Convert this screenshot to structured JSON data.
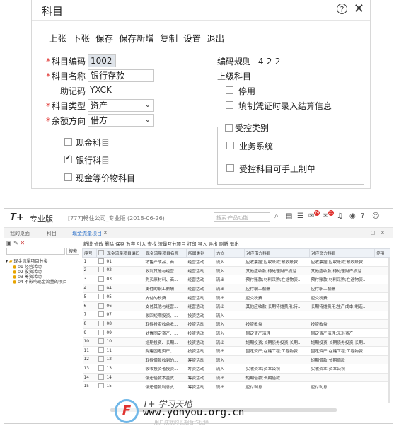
{
  "dialog": {
    "title": "科目",
    "toolbar": [
      "上张",
      "下张",
      "保存",
      "保存新增",
      "复制",
      "设置",
      "退出"
    ],
    "code_label": "科目编码",
    "code_value": "1002",
    "name_label": "科目名称",
    "name_value": "银行存款",
    "mnemonic_label": "助记码",
    "mnemonic_value": "YXCK",
    "type_label": "科目类型",
    "type_value": "资产",
    "balance_label": "余额方向",
    "balance_value": "借方",
    "rule_label": "编码规则",
    "rule_value": "4-2-2",
    "parent_label": "上级科目",
    "disable_label": "停用",
    "settle_label": "填制凭证时录入结算信息",
    "cash_label": "现金科目",
    "bank_label": "银行科目",
    "cash_equiv_label": "现金等价物科目",
    "controlled_label": "受控类别",
    "business_label": "业务系统",
    "manual_label": "受控科目可手工制单"
  },
  "app": {
    "logo": "T+",
    "brand": "专业版",
    "company": "[777]畅住公司_专业版   (2018-06-26)",
    "search_placeholder": "搜索:产品功能",
    "badge1": "74",
    "badge2": "21",
    "tabs": [
      "我的桌面",
      "科目",
      "现金流量项目"
    ],
    "tree_search_btn": "搜索",
    "tree_root": "现金流量项目分类",
    "tree_items": [
      "01 经营活动",
      "02 投资活动",
      "03 筹资活动",
      "04 不影响现金流量的项目"
    ],
    "toolbar": "新增  修改  删除  保存  放弃  引入  查找  流量互分项目  打印  导入  导出  刷新  退出",
    "columns": [
      "序号",
      "",
      "现金流量项目编码",
      "现金流量项目名称",
      "所属类别",
      "方向",
      "对应借方科目",
      "对应贷方科目",
      "停用"
    ],
    "rows": [
      [
        "1",
        "01",
        "销售产成品、商...",
        "经营活动",
        "流入",
        "应收票据;应收账款;预收账款",
        "应收票据;应收账款;预收账款"
      ],
      [
        "2",
        "02",
        "收到其他与经营...",
        "经营活动",
        "流入",
        "其他应收款;待处理财产损溢...",
        "其他应收款;待处理财产损溢..."
      ],
      [
        "3",
        "03",
        "购买原材料、商...",
        "经营活动",
        "流出",
        "预付账款;材料采购;在途物资...",
        "预付账款;材料采购;在途物资..."
      ],
      [
        "4",
        "04",
        "支付的职工薪酬",
        "经营活动",
        "流出",
        "应付职工薪酬",
        "应付职工薪酬"
      ],
      [
        "5",
        "05",
        "支付的税费",
        "经营活动",
        "流出",
        "应交税费",
        "应交税费"
      ],
      [
        "6",
        "06",
        "支付其他与经营...",
        "经营活动",
        "流出",
        "其他应收款;长期待摊费用;待...",
        "长期待摊费用;生产成本;制造..."
      ],
      [
        "7",
        "07",
        "收回短期投资、...",
        "投资活动",
        "流入",
        "",
        ""
      ],
      [
        "8",
        "08",
        "取得投资收益收...",
        "投资活动",
        "流入",
        "投资收益",
        "投资收益"
      ],
      [
        "9",
        "09",
        "处置固定资产、...",
        "投资活动",
        "流入",
        "固定资产清理",
        "固定资产清理;无形资产"
      ],
      [
        "10",
        "10",
        "短期投资、长期...",
        "投资活动",
        "流出",
        "短期投资;长期债券投资;长期...",
        "短期投资;长期债券投资;长期..."
      ],
      [
        "11",
        "11",
        "购建固定资产、...",
        "投资活动",
        "流出",
        "固定资产;在建工程;工程物资...",
        "固定资产;在建工程;工程物资..."
      ],
      [
        "12",
        "12",
        "取得借款收到的...",
        "筹资活动",
        "流入",
        "",
        "短期借款;长期借款"
      ],
      [
        "13",
        "13",
        "吸收投资者投资...",
        "筹资活动",
        "流入",
        "实收资本;资本公积",
        "实收资本;资本公积"
      ],
      [
        "14",
        "14",
        "偿还借款本金支...",
        "筹资活动",
        "流出",
        "短期借款;长期借款",
        ""
      ],
      [
        "15",
        "15",
        "偿还借款利息支...",
        "筹资活动",
        "流出",
        "应付利息",
        "应付利息"
      ]
    ]
  },
  "watermark": {
    "logo": "F",
    "cn": "T+ 学习天地",
    "url": "www.yonyou.org.cn",
    "sub": "用户成就的长期合作伙伴"
  }
}
